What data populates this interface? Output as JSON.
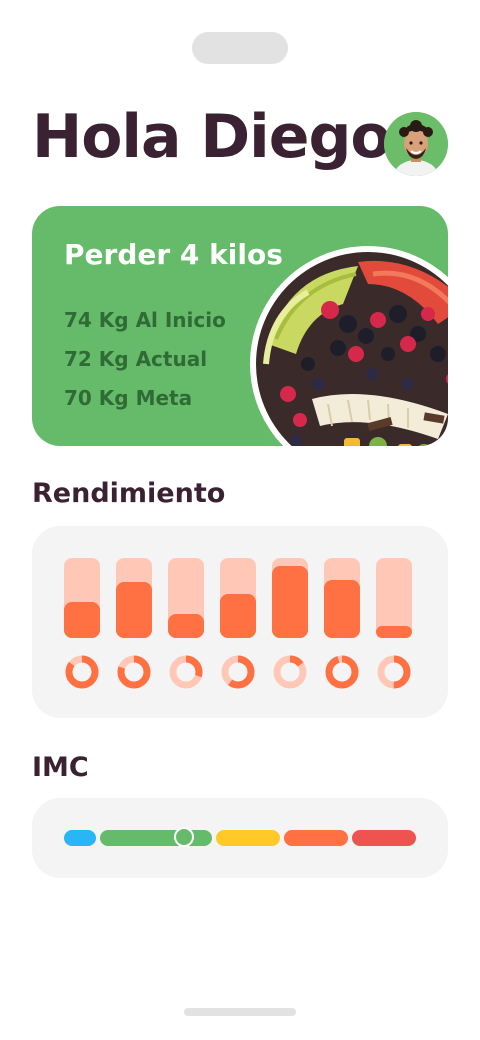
{
  "header": {
    "greeting": "Hola Diego"
  },
  "goal": {
    "title": "Perder 4 kilos",
    "stats": [
      "74 Kg Al Inicio",
      "72 Kg Actual",
      "70 Kg Meta"
    ]
  },
  "performance": {
    "title": "Rendimiento",
    "bars": [
      0.45,
      0.7,
      0.3,
      0.55,
      0.9,
      0.72,
      0.15
    ],
    "donuts": [
      0.85,
      0.8,
      0.3,
      0.6,
      0.15,
      0.95,
      0.5
    ]
  },
  "imc": {
    "title": "IMC",
    "segments": [
      "#29b6f6",
      "#66bb6a",
      "#ffca28",
      "#ff7043",
      "#ef5350"
    ],
    "indicator_segment": 1
  },
  "colors": {
    "primary_green": "#66bb6a",
    "accent_orange": "#ff7043",
    "light_orange": "#ffc8b6",
    "text_dark": "#3a2232"
  }
}
